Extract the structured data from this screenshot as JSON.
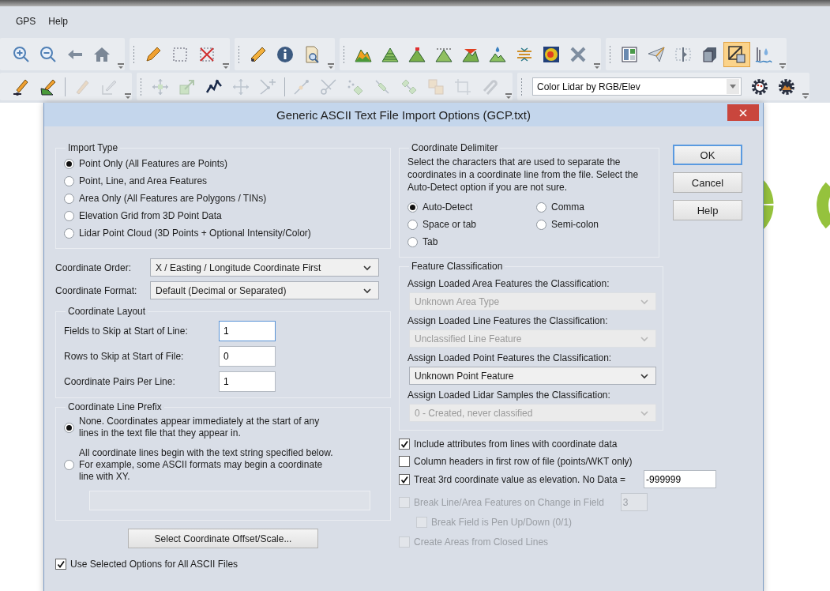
{
  "menu": [
    {
      "label": "GPS"
    },
    {
      "label": "Help"
    }
  ],
  "toolbars": [
    {
      "groups": [
        [
          {
            "selected": false
          },
          {
            "selected": false
          },
          {
            "selected": false
          },
          {
            "selected": false
          }
        ],
        [
          {
            "selected": false
          },
          {
            "selected": false
          },
          {
            "selected": false
          }
        ],
        [
          {
            "selected": false
          },
          {
            "selected": false
          },
          {
            "selected": false
          }
        ],
        [
          {
            "selected": false
          },
          {
            "selected": false
          },
          {
            "selected": false
          },
          {
            "selected": false
          },
          {
            "selected": false
          },
          {
            "selected": false
          },
          {
            "selected": false
          },
          {
            "selected": false
          },
          {
            "selected": false
          }
        ],
        [
          {
            "selected": false
          },
          {
            "selected": false
          },
          {
            "selected": false
          },
          {
            "selected": false
          },
          {
            "selected": true
          },
          {
            "selected": false
          }
        ]
      ]
    },
    {
      "groups": [
        [
          {
            "disabled": false
          },
          {
            "disabled": false
          },
          {
            "disabled": true
          },
          {
            "disabled": true
          }
        ],
        [
          {
            "disabled": true
          },
          {
            "disabled": true
          },
          {
            "disabled": false
          },
          {
            "disabled": true
          },
          {
            "disabled": true
          },
          {
            "disabled": true
          },
          {
            "disabled": true
          },
          {
            "disabled": true
          },
          {
            "disabled": true
          },
          {
            "disabled": true
          },
          {
            "disabled": true
          },
          {
            "disabled": true
          },
          {
            "disabled": true
          }
        ],
        [
          {
            "disabled": false
          },
          {
            "disabled": false
          }
        ]
      ],
      "combo": {
        "value": "Color Lidar by RGB/Elev"
      }
    }
  ],
  "dialog": {
    "title": "Generic ASCII Text File Import Options (GCP.txt)",
    "import_type": {
      "label": "Import Type",
      "options": [
        {
          "label": "Point Only (All Features are Points)",
          "selected": true
        },
        {
          "label": "Point, Line, and Area Features",
          "selected": false
        },
        {
          "label": "Area Only (All Features are Polygons / TINs)",
          "selected": false
        },
        {
          "label": "Elevation Grid from 3D Point Data",
          "selected": false
        },
        {
          "label": "Lidar Point Cloud (3D Points + Optional Intensity/Color)",
          "selected": false
        }
      ]
    },
    "coordinate_order": {
      "label": "Coordinate Order:",
      "value": "X / Easting / Longitude Coordinate First"
    },
    "coordinate_format": {
      "label": "Coordinate Format:",
      "value": "Default (Decimal or Separated)"
    },
    "coordinate_layout": {
      "label": "Coordinate Layout",
      "fields": [
        {
          "label": "Fields to Skip at Start of Line:",
          "value": "1",
          "focused": true
        },
        {
          "label": "Rows to Skip at Start of File:",
          "value": "0",
          "focused": false
        },
        {
          "label": "Coordinate Pairs Per Line:",
          "value": "1",
          "focused": false
        }
      ]
    },
    "coordinate_line_prefix": {
      "label": "Coordinate Line Prefix",
      "options": [
        {
          "label": "None. Coordinates appear immediately at the start of any lines in the text file that they appear in.",
          "selected": true
        },
        {
          "label": "All coordinate lines begin with the text string specified below. For example, some ASCII formats may begin a coordinate line with XY.",
          "selected": false
        }
      ],
      "prefix_field_disabled": true
    },
    "offset_button": "Select Coordinate Offset/Scale...",
    "use_for_all": {
      "label": "Use Selected Options for All ASCII Files",
      "checked": true
    },
    "coordinate_delimiter": {
      "label": "Coordinate Delimiter",
      "description": "Select the characters that are used to separate the coordinates in a coordinate line from the file. Select the Auto-Detect option if you are not sure.",
      "options": [
        {
          "label": "Auto-Detect",
          "selected": true
        },
        {
          "label": "Comma",
          "selected": false
        },
        {
          "label": "Space or tab",
          "selected": false
        },
        {
          "label": "Semi-colon",
          "selected": false
        },
        {
          "label": "Tab",
          "selected": false
        }
      ]
    },
    "feature_classification": {
      "label": "Feature Classification",
      "assignments": [
        {
          "label": "Assign Loaded Area Features the Classification:",
          "value": "Unknown Area Type",
          "disabled": true
        },
        {
          "label": "Assign Loaded Line Features the Classification:",
          "value": "Unclassified Line Feature",
          "disabled": true
        },
        {
          "label": "Assign Loaded Point Features the Classification:",
          "value": "Unknown Point Feature",
          "disabled": false
        },
        {
          "label": "Assign Loaded Lidar Samples the Classification:",
          "value": "0 - Created, never classified",
          "disabled": true
        }
      ]
    },
    "options": [
      {
        "label": "Include attributes from lines with coordinate data",
        "checked": true,
        "disabled": false
      },
      {
        "label": "Column headers in first row of file (points/WKT only)",
        "checked": false,
        "disabled": false
      },
      {
        "label": "Treat 3rd coordinate value as elevation. No Data =",
        "checked": true,
        "disabled": false,
        "field": "-999999"
      },
      {
        "label": "Break Line/Area Features on Change in Field",
        "checked": false,
        "disabled": true,
        "field": "3",
        "children": [
          {
            "label": "Break Field is Pen Up/Down (0/1)",
            "checked": false,
            "disabled": true
          }
        ]
      },
      {
        "label": "Create Areas from Closed Lines",
        "checked": false,
        "disabled": true
      }
    ],
    "buttons": [
      {
        "label": "OK",
        "default": true
      },
      {
        "label": "Cancel",
        "default": false
      },
      {
        "label": "Help",
        "default": false
      }
    ]
  }
}
